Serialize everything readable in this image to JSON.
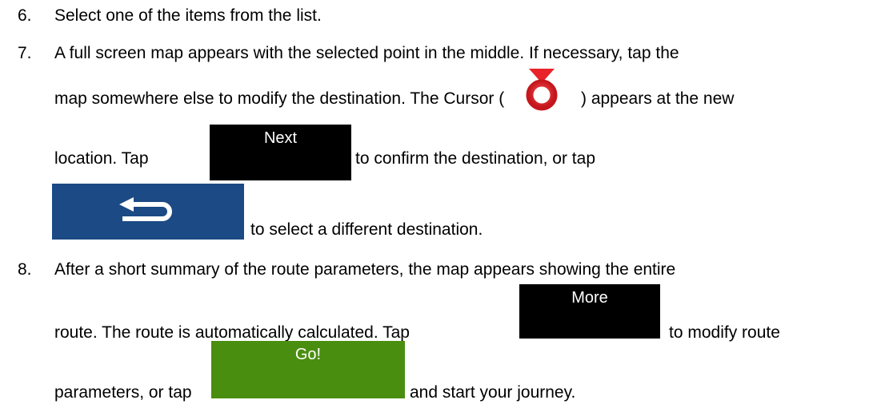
{
  "steps": [
    {
      "number": "6.",
      "lines": [
        "Select one of the items from the list."
      ]
    },
    {
      "number": "7.",
      "lines": [
        "A full screen map appears with the selected point in the middle. If necessary, tap the",
        "map somewhere else to modify the destination. The Cursor (",
        ") appears at the new",
        "location. Tap",
        "to confirm the destination, or tap",
        "to select a different destination."
      ]
    },
    {
      "number": "8.",
      "lines": [
        "After a short summary of the route parameters, the map appears showing the entire",
        "route. The route is automatically calculated. Tap",
        "to modify route",
        "parameters, or tap",
        "and start your journey."
      ]
    }
  ],
  "buttons": {
    "next_label": "Next",
    "back_icon": "back-arrow-icon",
    "more_label": "More",
    "go_label": "Go!"
  },
  "icons": {
    "cursor": "cursor-icon"
  },
  "colors": {
    "next_bg": "#000000",
    "back_bg": "#1b4a84",
    "more_bg": "#000000",
    "go_bg": "#4a8e0f",
    "cursor_red": "#e8232a"
  }
}
